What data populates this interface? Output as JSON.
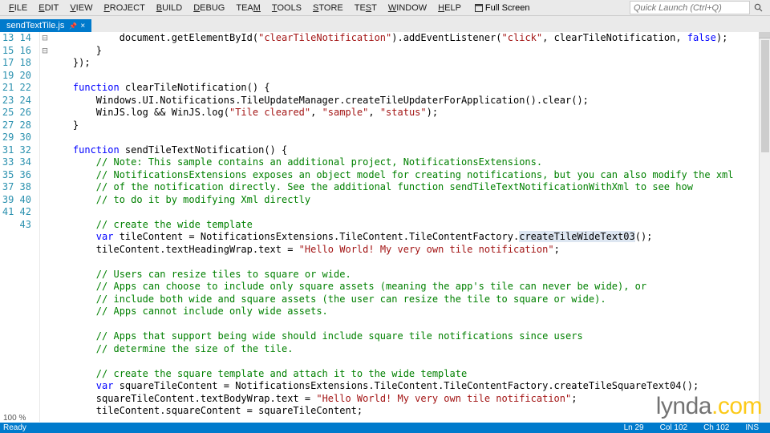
{
  "menu": {
    "items": [
      "FILE",
      "EDIT",
      "VIEW",
      "PROJECT",
      "BUILD",
      "DEBUG",
      "TEAM",
      "TOOLS",
      "STORE",
      "TEST",
      "WINDOW",
      "HELP"
    ],
    "fullscreen": "Full Screen",
    "quick_launch_placeholder": "Quick Launch (Ctrl+Q)"
  },
  "tab": {
    "filename": "sendTextTile.js"
  },
  "editor": {
    "first_line": 13,
    "lines": [
      "            document.getElementById(\"clearTileNotification\").addEventListener(\"click\", clearTileNotification, false);",
      "        }",
      "    });",
      "",
      "    function clearTileNotification() {",
      "        Windows.UI.Notifications.TileUpdateManager.createTileUpdaterForApplication().clear();",
      "        WinJS.log && WinJS.log(\"Tile cleared\", \"sample\", \"status\");",
      "    }",
      "",
      "    function sendTileTextNotification() {",
      "        // Note: This sample contains an additional project, NotificationsExtensions.",
      "        // NotificationsExtensions exposes an object model for creating notifications, but you can also modify the xml",
      "        // of the notification directly. See the additional function sendTileTextNotificationWithXml to see how",
      "        // to do it by modifying Xml directly",
      "",
      "        // create the wide template",
      "        var tileContent = NotificationsExtensions.TileContent.TileContentFactory.createTileWideText03();",
      "        tileContent.textHeadingWrap.text = \"Hello World! My very own tile notification\";",
      "",
      "        // Users can resize tiles to square or wide.",
      "        // Apps can choose to include only square assets (meaning the app's tile can never be wide), or",
      "        // include both wide and square assets (the user can resize the tile to square or wide).",
      "        // Apps cannot include only wide assets.",
      "",
      "        // Apps that support being wide should include square tile notifications since users",
      "        // determine the size of the tile.",
      "",
      "        // create the square template and attach it to the wide template",
      "        var squareTileContent = NotificationsExtensions.TileContent.TileContentFactory.createTileSquareText04();",
      "        squareTileContent.textBodyWrap.text = \"Hello World! My very own tile notification\";",
      "        tileContent.squareContent = squareTileContent;"
    ],
    "highlight_token": "createTileWideText03"
  },
  "status": {
    "ready": "Ready",
    "ln": "Ln 29",
    "col": "Col 102",
    "ch": "Ch 102",
    "ins": "INS"
  },
  "zoom": "100 %",
  "watermark": {
    "a": "lynda",
    "b": ".com"
  }
}
